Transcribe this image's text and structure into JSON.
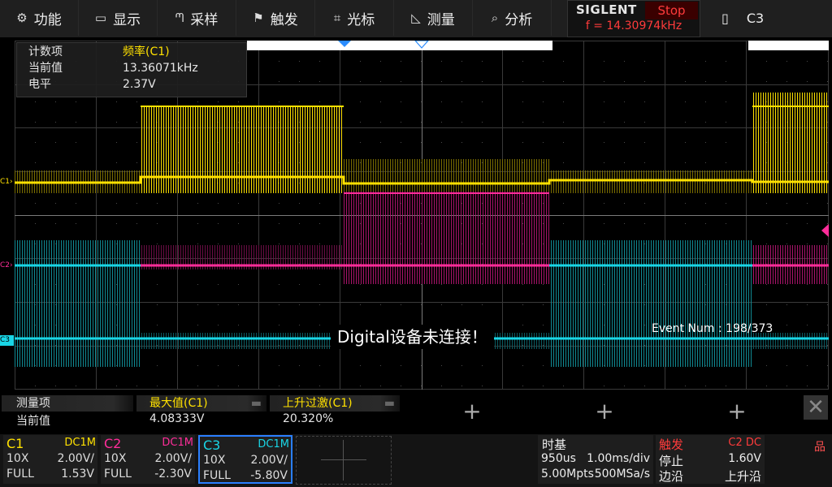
{
  "menu": {
    "items": [
      {
        "icon": "gear-icon",
        "glyph": "⚙",
        "label": "功能"
      },
      {
        "icon": "monitor-icon",
        "glyph": "▭",
        "label": "显示"
      },
      {
        "icon": "sample-icon",
        "glyph": "ᘉ",
        "label": "采样"
      },
      {
        "icon": "flag-icon",
        "glyph": "⚑",
        "label": "触发"
      },
      {
        "icon": "cursor-icon",
        "glyph": "⌗",
        "label": "光标"
      },
      {
        "icon": "measure-icon",
        "glyph": "◺",
        "label": "测量"
      },
      {
        "icon": "analyze-icon",
        "glyph": "⌕",
        "label": "分析"
      }
    ]
  },
  "status": {
    "brand": "SIGLENT",
    "run_state": "Stop",
    "trigger_freq": "f = 14.30974kHz",
    "channel_icon": "battery-icon",
    "channel_glyph": "▯",
    "active_channel": "C3"
  },
  "measure_box": {
    "rows": [
      {
        "label": "计数项",
        "value": "频率(C1)"
      },
      {
        "label": "当前值",
        "value": "13.36071kHz"
      },
      {
        "label": "电平",
        "value": "2.37V"
      }
    ]
  },
  "markers": {
    "c1": "C1",
    "c2": "C2",
    "c3": "C3"
  },
  "overlay": {
    "digital_msg": "Digital设备未连接！",
    "event_num": "Event Num : 198/373"
  },
  "measure_panel": {
    "row_labels": [
      "测量项",
      "当前值"
    ],
    "items": [
      {
        "name": "最大值(C1)",
        "value": "4.08333V"
      },
      {
        "name": "上升过激(C1)",
        "value": "20.320%"
      }
    ]
  },
  "channels": [
    {
      "name": "C1",
      "coupling": "DC1M",
      "probe": "10X",
      "scale": "2.00V/",
      "bw": "FULL",
      "offset": "1.53V",
      "color": "#ffe100"
    },
    {
      "name": "C2",
      "coupling": "DC1M",
      "probe": "10X",
      "scale": "2.00V/",
      "bw": "FULL",
      "offset": "-2.30V",
      "color": "#ff2d9a"
    },
    {
      "name": "C3",
      "coupling": "DC1M",
      "probe": "10X",
      "scale": "2.00V/",
      "bw": "FULL",
      "offset": "-5.80V",
      "color": "#19d6e6"
    }
  ],
  "timebase": {
    "title": "时基",
    "delay": "950us",
    "scale": "1.00ms/div",
    "depth": "5.00Mpts",
    "rate": "500MSa/s"
  },
  "trigger": {
    "title": "触发",
    "source": "C2 DC",
    "mode": "停止",
    "level": "1.60V",
    "type": "边沿",
    "slope": "上升沿"
  },
  "network_icon": "network-icon",
  "network_glyph": "品",
  "colors": {
    "c1": "#ffe100",
    "c2": "#ff2d9a",
    "c3": "#19d6e6",
    "stop_red": "#ff3b3b",
    "trigger_red": "#ff3b3b",
    "menu_bg": "#1f1f1f"
  }
}
